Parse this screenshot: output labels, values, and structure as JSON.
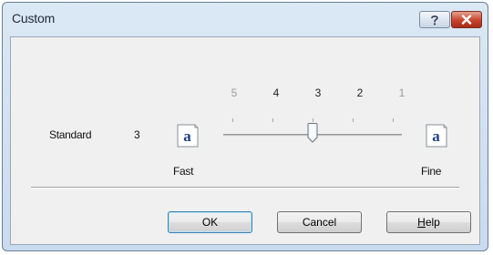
{
  "window": {
    "title": "Custom"
  },
  "titlebar": {
    "help_icon": "question-icon",
    "close_icon": "close-x-icon"
  },
  "quality": {
    "label": "Standard",
    "value": "3",
    "scale": [
      "5",
      "4",
      "3",
      "2",
      "1"
    ],
    "scale_enabled": [
      false,
      true,
      true,
      true,
      false
    ],
    "min": 1,
    "max": 5,
    "selected": 3,
    "fast_label": "Fast",
    "fine_label": "Fine",
    "icon_glyph": "a",
    "icons": [
      "fast-quality-icon",
      "fine-quality-icon"
    ]
  },
  "buttons": {
    "ok": "OK",
    "cancel": "Cancel",
    "help_mnemonic": "H",
    "help_rest": "elp"
  },
  "colors": {
    "client": "#f0f0f0",
    "icon_letter": "#1d3f86",
    "close": "#c8432c"
  }
}
